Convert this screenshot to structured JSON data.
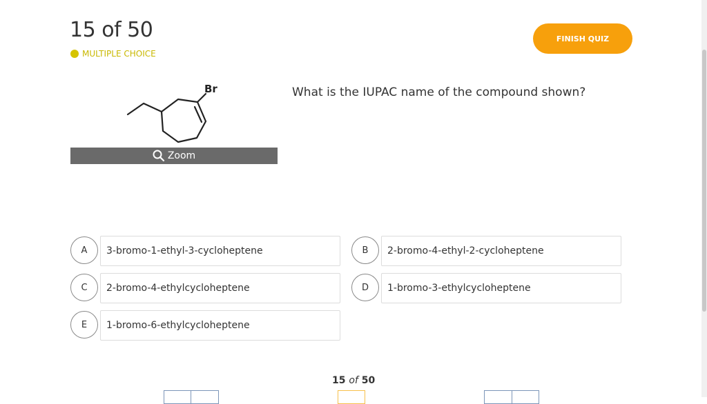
{
  "header": {
    "counter": "15 of 50",
    "question_type": "MULTIPLE CHOICE",
    "finish_label": "FINISH QUIZ"
  },
  "figure": {
    "atom_label": "Br",
    "zoom_label": "Zoom"
  },
  "question": "What is the IUPAC name of the compound shown?",
  "options": [
    {
      "letter": "A",
      "text": "3-bromo-1-ethyl-3-cycloheptene"
    },
    {
      "letter": "B",
      "text": "2-bromo-4-ethyl-2-cycloheptene"
    },
    {
      "letter": "C",
      "text": "2-bromo-4-ethylcycloheptene"
    },
    {
      "letter": "D",
      "text": "1-bromo-3-ethylcycloheptene"
    },
    {
      "letter": "E",
      "text": "1-bromo-6-ethylcycloheptene"
    }
  ],
  "pager": {
    "current": "15",
    "of": "of",
    "total": "50"
  },
  "colors": {
    "accent": "#f7a00c",
    "question_type": "#d6c400",
    "zoom_bar": "#6a6a6a"
  }
}
